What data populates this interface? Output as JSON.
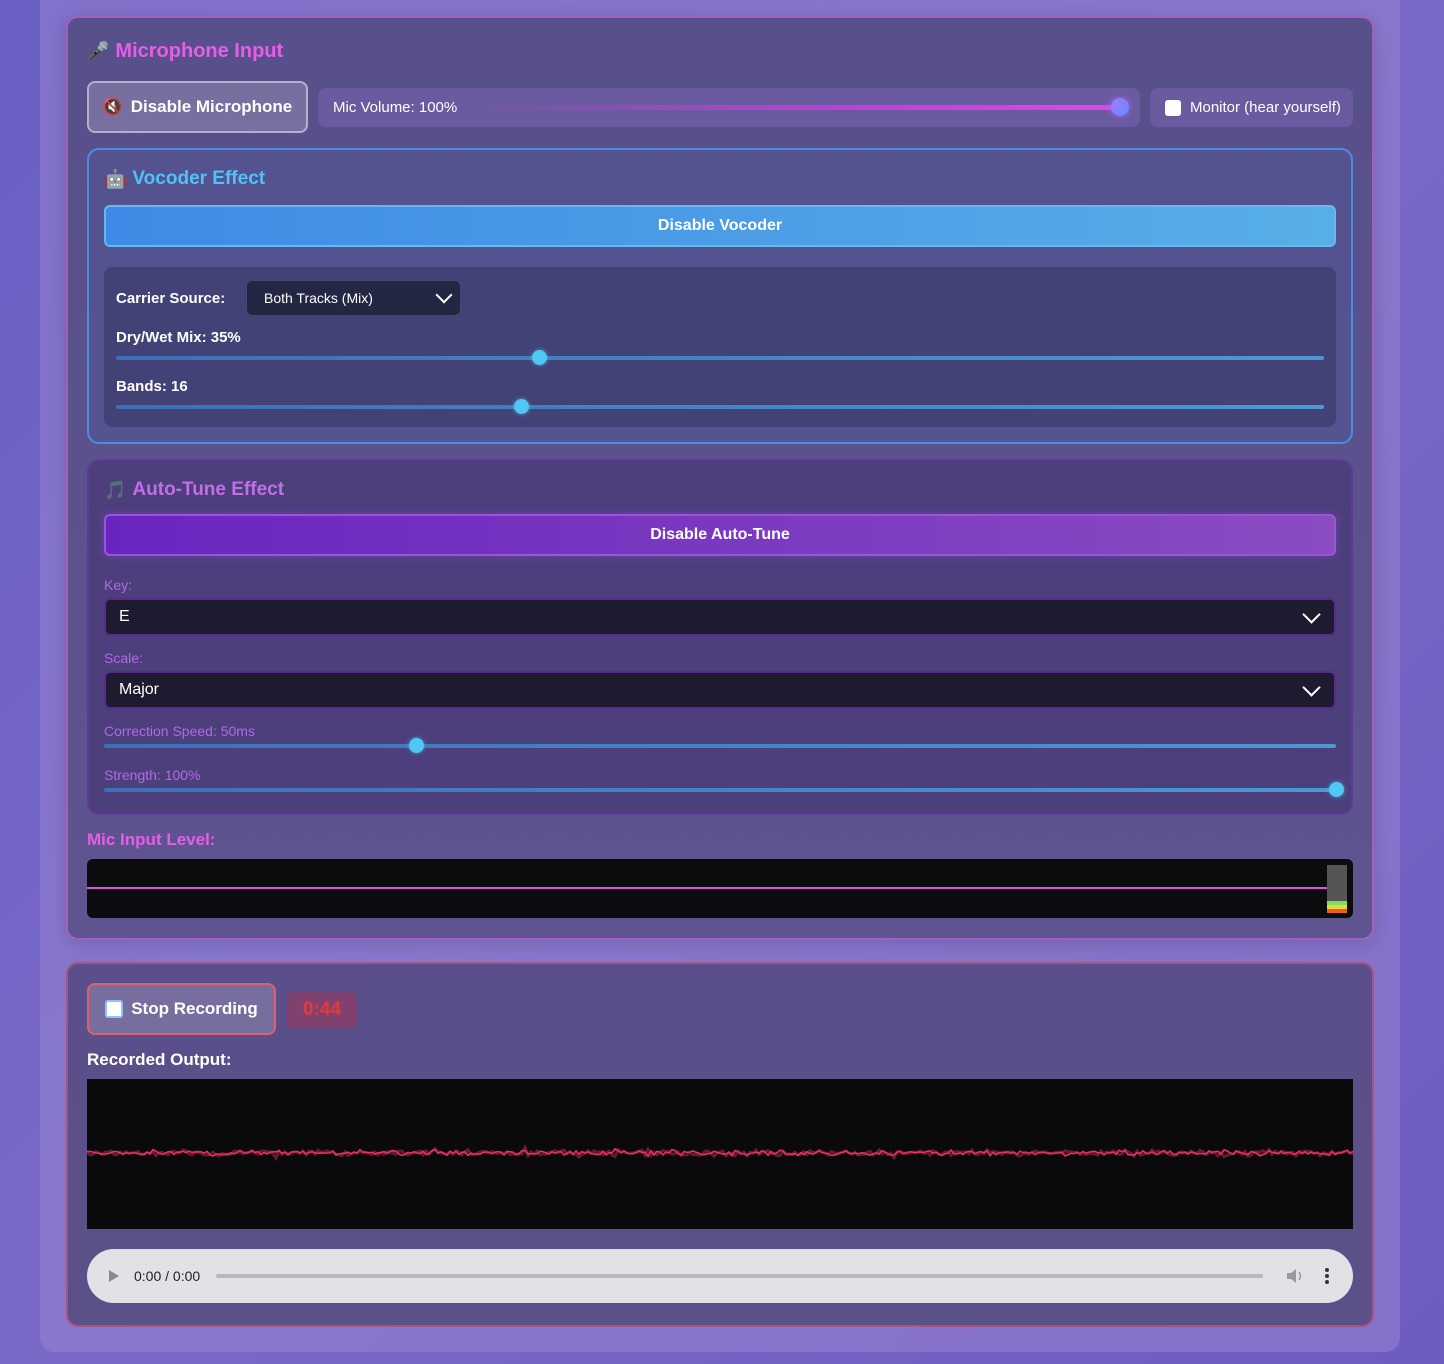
{
  "mic": {
    "title": "Microphone Input",
    "title_icon": "microphone-icon",
    "disable_button": "Disable Microphone",
    "volume_label": "Mic Volume: 100%",
    "volume_value": 100,
    "monitor_label": "Monitor (hear yourself)",
    "monitor_checked": false
  },
  "vocoder": {
    "title": "Vocoder Effect",
    "title_icon": "robot-icon",
    "disable_button": "Disable Vocoder",
    "carrier_label": "Carrier Source:",
    "carrier_value": "Both Tracks (Mix)",
    "drywet_label": "Dry/Wet Mix: 35%",
    "drywet_value": 0.35,
    "bands_label": "Bands: 16",
    "bands_value": 0.335
  },
  "autotune": {
    "title": "Auto-Tune Effect",
    "title_icon": "music-note-icon",
    "disable_button": "Disable Auto-Tune",
    "key_label": "Key:",
    "key_value": "E",
    "scale_label": "Scale:",
    "scale_value": "Major",
    "speed_label": "Correction Speed: 50ms",
    "speed_value": 0.253,
    "strength_label": "Strength: 100%",
    "strength_value": 1.0
  },
  "level": {
    "label": "Mic Input Level:"
  },
  "recording": {
    "stop_button": "Stop Recording",
    "timer": "0:44",
    "output_label": "Recorded Output:",
    "player_time": "0:00 / 0:00"
  },
  "colors": {
    "accent_pink": "#e65ee6",
    "accent_cyan": "#4fc3f7",
    "accent_violet": "#c36ee8",
    "waveform": "#e8305c"
  }
}
